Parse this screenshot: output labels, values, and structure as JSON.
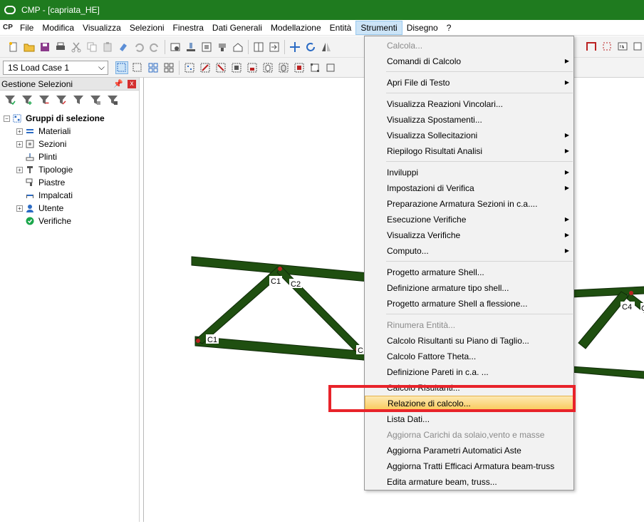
{
  "window": {
    "title": "CMP - [capriata_HE]"
  },
  "menubar": {
    "logo": "CP",
    "items": [
      "File",
      "Modifica",
      "Visualizza",
      "Selezioni",
      "Finestra",
      "Dati Generali",
      "Modellazione",
      "Entità",
      "Strumenti",
      "Disegno",
      "?"
    ],
    "active": "Strumenti"
  },
  "toolbar": {
    "load_case": "1S Load Case 1"
  },
  "panel": {
    "title": "Gestione Selezioni",
    "pin": "ᵖ",
    "close": "x",
    "tree": {
      "root": "Gruppi di selezione",
      "children": [
        "Materiali",
        "Sezioni",
        "Plinti",
        "Tipologie",
        "Piastre",
        "Impalcati",
        "Utente",
        "Verifiche"
      ]
    }
  },
  "canvas": {
    "node_labels": [
      "C1",
      "C2",
      "C1",
      "C",
      "C4",
      "C"
    ],
    "beam_color": "#1f4f10"
  },
  "dropdown": {
    "items": [
      {
        "label": "Calcola...",
        "disabled": true
      },
      {
        "label": "Comandi di Calcolo",
        "submenu": true
      },
      {
        "label": "Apri File di Testo",
        "submenu": true
      },
      {
        "label": "Visualizza Reazioni Vincolari..."
      },
      {
        "label": "Visualizza Spostamenti..."
      },
      {
        "label": "Visualizza Sollecitazioni",
        "submenu": true
      },
      {
        "label": "Riepilogo Risultati Analisi",
        "submenu": true
      },
      {
        "label": "Inviluppi",
        "submenu": true
      },
      {
        "label": "Impostazioni di Verifica",
        "submenu": true
      },
      {
        "label": "Preparazione Armatura Sezioni in c.a...."
      },
      {
        "label": "Esecuzione Verifiche",
        "submenu": true
      },
      {
        "label": "Visualizza Verifiche",
        "submenu": true
      },
      {
        "label": "Computo...",
        "submenu": true
      },
      {
        "label": "Progetto armature Shell..."
      },
      {
        "label": "Definizione armature tipo shell..."
      },
      {
        "label": "Progetto armature Shell a flessione..."
      },
      {
        "label": "Rinumera Entità...",
        "disabled": true
      },
      {
        "label": "Calcolo Risultanti su Piano di Taglio..."
      },
      {
        "label": "Calcolo Fattore Theta..."
      },
      {
        "label": "Definizione Pareti in c.a. ..."
      },
      {
        "label": "Calcolo Risultanti..."
      },
      {
        "label": "Relazione di calcolo...",
        "highlighted": true
      },
      {
        "label": "Lista Dati..."
      },
      {
        "label": "Aggiorna Carichi da solaio,vento e masse",
        "disabled": true
      },
      {
        "label": "Aggiorna Parametri Automatici Aste"
      },
      {
        "label": "Aggiorna Tratti Efficaci Armatura beam-truss"
      },
      {
        "label": "Edita armature beam, truss..."
      }
    ]
  },
  "colors": {
    "title_bar": "#1f7b1f",
    "highlight": "#f9c858",
    "annotation": "#e8232a"
  }
}
